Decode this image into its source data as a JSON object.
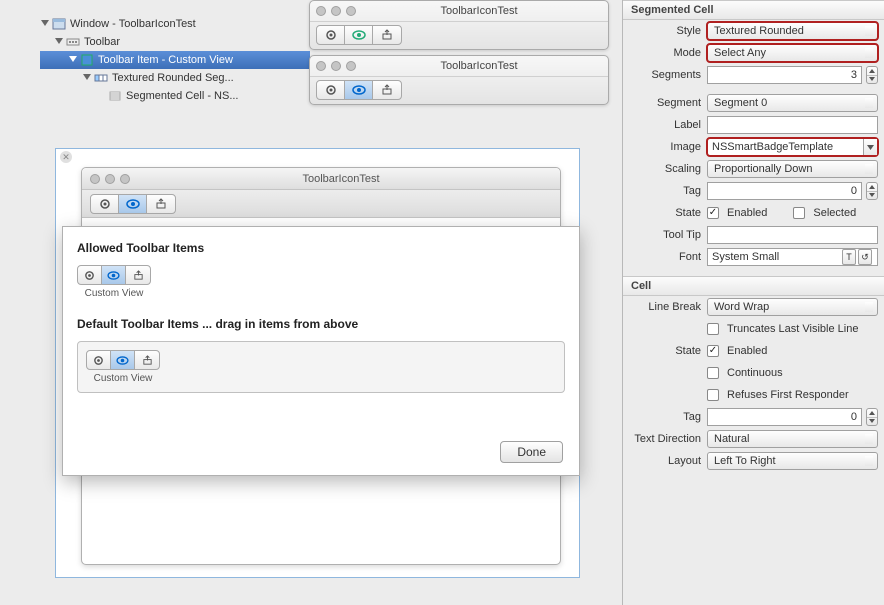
{
  "tree": {
    "window": "Window - ToolbarIconTest",
    "toolbar": "Toolbar",
    "toolbar_item": "Toolbar Item - Custom View",
    "textured": "Textured Rounded Seg...",
    "segmented_cell": "Segmented Cell - NS..."
  },
  "mini_title": "ToolbarIconTest",
  "canvas": {
    "window_title": "ToolbarIconTest",
    "sheet_allowed": "Allowed Toolbar Items",
    "sheet_default": "Default Toolbar Items ... drag in items from above",
    "custom_view": "Custom View",
    "done": "Done"
  },
  "inspector": {
    "segmented_cell_title": "Segmented Cell",
    "style_label": "Style",
    "style_value": "Textured Rounded",
    "mode_label": "Mode",
    "mode_value": "Select Any",
    "segments_label": "Segments",
    "segments_value": "3",
    "segment_label": "Segment",
    "segment_value": "Segment 0",
    "label_label": "Label",
    "label_value": "",
    "image_label": "Image",
    "image_value": "NSSmartBadgeTemplate",
    "scaling_label": "Scaling",
    "scaling_value": "Proportionally Down",
    "tag_label": "Tag",
    "tag_value": "0",
    "state_label": "State",
    "state_enabled": "Enabled",
    "state_selected": "Selected",
    "tooltip_label": "Tool Tip",
    "tooltip_value": "",
    "font_label": "Font",
    "font_value": "System Small",
    "cell_title": "Cell",
    "linebreak_label": "Line Break",
    "linebreak_value": "Word Wrap",
    "truncates": "Truncates Last Visible Line",
    "cell_state_label": "State",
    "cell_enabled": "Enabled",
    "cell_continuous": "Continuous",
    "cell_refuses": "Refuses First Responder",
    "cell_tag_label": "Tag",
    "cell_tag_value": "0",
    "textdir_label": "Text Direction",
    "textdir_value": "Natural",
    "layout_label": "Layout",
    "layout_value": "Left To Right"
  }
}
